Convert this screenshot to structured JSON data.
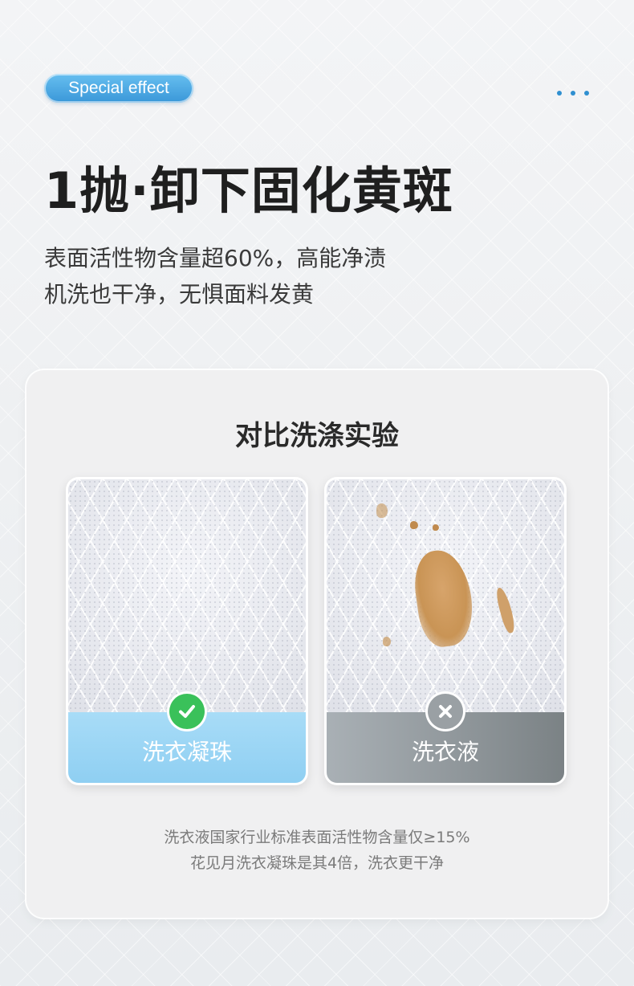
{
  "badge": {
    "label": "Special effect"
  },
  "header": {
    "headline": "1抛·卸下固化黄斑",
    "desc_line1": "表面活性物含量超60%，高能净渍",
    "desc_line2": "机洗也干净，无惧面料发黄"
  },
  "comparison": {
    "title": "对比洗涤实验",
    "left": {
      "label": "洗衣凝珠",
      "result_icon": "check-icon",
      "color": "#3ac15a"
    },
    "right": {
      "label": "洗衣液",
      "result_icon": "cross-icon",
      "color": "#9aa0a4"
    }
  },
  "footnote": {
    "line1": "洗衣液国家行业标准表面活性物含量仅≥15%",
    "line2": "花见月洗衣凝珠是其4倍，洗衣更干净"
  },
  "colors": {
    "accent": "#3a97d8",
    "text_dark": "#1f1f1f",
    "text_muted": "#7a7a7a"
  }
}
